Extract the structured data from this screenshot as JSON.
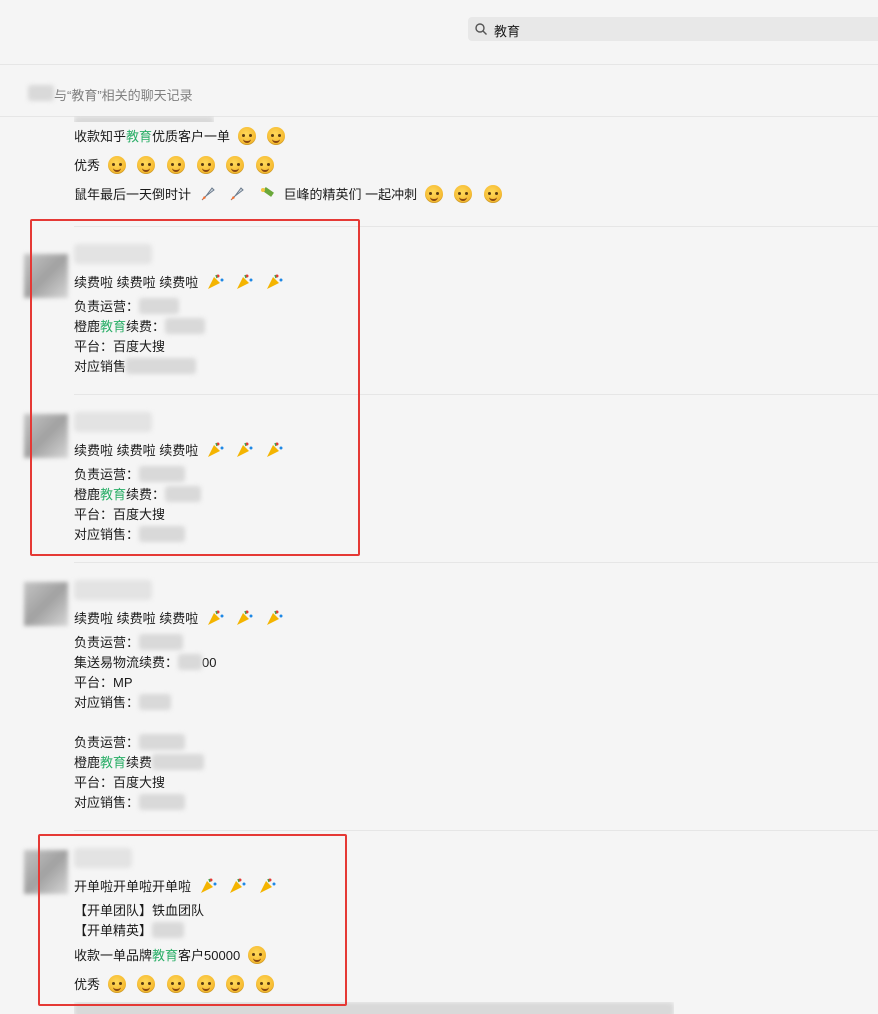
{
  "search": {
    "query": "教育"
  },
  "subhead": {
    "text": "与“教育”相关的聊天记录"
  },
  "prev_message": {
    "line1_a": "收款知乎",
    "line1_hl": "教育",
    "line1_b": "优质客户一单",
    "line2": "优秀",
    "line3_a": "鼠年最后一天倒时计",
    "line3_b": "巨峰的精英们 一起冲刺"
  },
  "messages": [
    {
      "lines": {
        "headline": "续费啦 续费啦 续费啦",
        "ops_label": "负责运营：",
        "client_a": "橙鹿",
        "client_hl": "教育",
        "client_b": "续费：",
        "platform": "平台：百度大搜",
        "sales_label": "对应销售"
      }
    },
    {
      "lines": {
        "headline": "续费啦 续费啦 续费啦",
        "ops_label": "负责运营：",
        "client_a": "橙鹿",
        "client_hl": "教育",
        "client_b": "续费：",
        "platform": "平台：百度大搜",
        "sales_label": "对应销售："
      }
    },
    {
      "lines": {
        "headline": "续费啦 续费啦 续费啦",
        "ops_label": "负责运营：",
        "client2": "集送易物流续费：",
        "client2_tail": "00",
        "platform2": "平台：MP",
        "sales_label": "对应销售：",
        "ops_label2": "负责运营：",
        "client_a": "橙鹿",
        "client_hl": "教育",
        "client_b": "续费",
        "platform": "平台：百度大搜",
        "sales_label2": "对应销售："
      }
    },
    {
      "lines": {
        "headline": "开单啦开单啦开单啦",
        "team": "【开单团队】铁血团队",
        "elite": "【开单精英】",
        "collect_a": "收款一单品牌",
        "collect_hl": "教育",
        "collect_b": "客户50000",
        "good": "优秀"
      }
    }
  ],
  "colors": {
    "highlight": "#2aae67",
    "annotation": "#e53935"
  }
}
